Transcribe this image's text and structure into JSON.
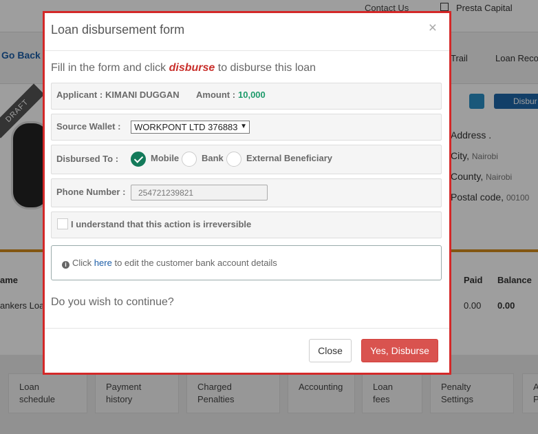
{
  "background": {
    "contact_label": "Contact Us",
    "company_name": "Presta Capital",
    "go_back": "Go Back",
    "tab_trail": "Trail",
    "tab_loan_records": "Loan Reco",
    "draft_ribbon": "DRAFT",
    "disburse_button": "Disbur",
    "address_label": "Address .",
    "city_label": "City,",
    "city_value": "Nairobi",
    "county_label": "County,",
    "county_value": "Nairobi",
    "postal_label": "Postal code,",
    "postal_value": "00100",
    "table_headers": {
      "name": "ame",
      "paid": "Paid",
      "balance": "Balance"
    },
    "table_row": {
      "name": "ankers Loa",
      "paid": "0.00",
      "balance": "0.00"
    },
    "bottom_tabs": [
      "Loan schedule",
      "Payment history",
      "Charged Penalties",
      "Accounting",
      "Loan fees",
      "Penalty Settings",
      "A P"
    ]
  },
  "modal": {
    "title": "Loan disbursement form",
    "close_symbol": "×",
    "intro_prefix": "Fill in the form and click",
    "intro_keyword": "disburse",
    "intro_suffix": "to disburse this loan",
    "applicant_label": "Applicant :",
    "applicant_value": "KIMANI DUGGAN",
    "amount_label": "Amount :",
    "amount_value": "10,000",
    "source_wallet_label": "Source Wallet :",
    "source_wallet_value": "WORKPONT LTD 376883",
    "disbursed_to_label": "Disbursed To :",
    "disbursed_to_options": [
      "Mobile",
      "Bank",
      "External Beneficiary"
    ],
    "disbursed_to_selected": "Mobile",
    "phone_label": "Phone Number :",
    "phone_value": "254721239821",
    "confirm_label": "I understand that this action is irreversible",
    "info_prefix": "Click",
    "info_link": "here",
    "info_suffix": "to edit the customer bank account details",
    "question": "Do you wish to continue?",
    "close_button": "Close",
    "disburse_button": "Yes, Disburse"
  },
  "colors": {
    "highlight_border": "#d42828",
    "amount_green": "#1e9b6b",
    "radio_checked": "#137a5a",
    "disburse_red": "#d9534f",
    "link_blue": "#1c5ea8"
  }
}
